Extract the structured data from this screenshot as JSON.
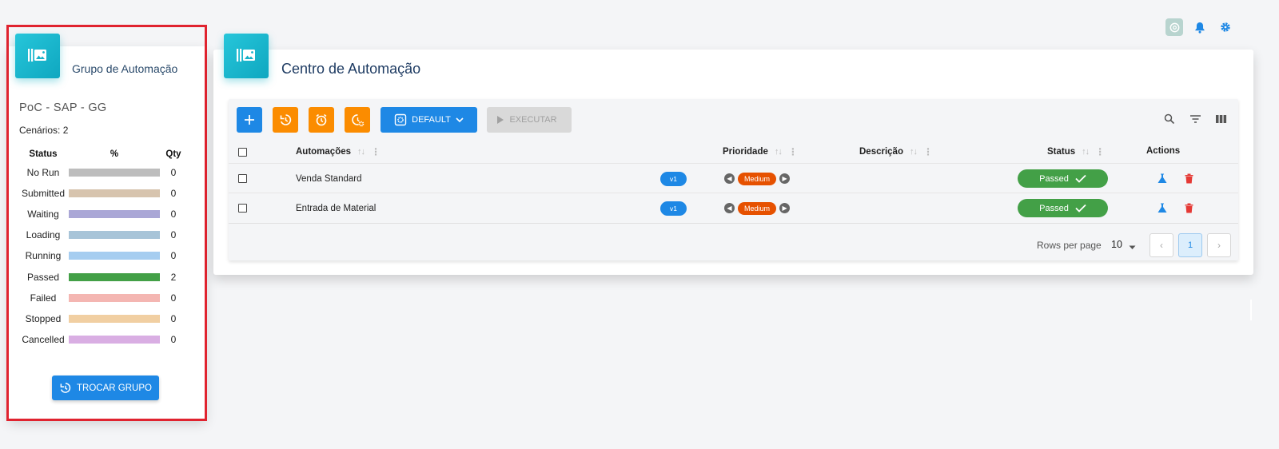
{
  "colors": {
    "accent": "#1e88e5",
    "orange": "#fb8c00",
    "teal": "#26c6da",
    "passed": "#43a047",
    "priority": "#e65100",
    "delete": "#e53935"
  },
  "header_icons": [
    "chatgpt-icon",
    "bell-icon",
    "gear-icon"
  ],
  "group_card": {
    "title": "Grupo de Automação",
    "group_name": "PoC - SAP - GG",
    "scenarios": "Cenários: 2",
    "columns": {
      "status": "Status",
      "percent": "%",
      "qty": "Qty"
    },
    "rows": [
      {
        "status": "No Run",
        "qty": "0",
        "color": "#bdbdbd"
      },
      {
        "status": "Submitted",
        "qty": "0",
        "color": "#d7c4ae"
      },
      {
        "status": "Waiting",
        "qty": "0",
        "color": "#aaa7d6"
      },
      {
        "status": "Loading",
        "qty": "0",
        "color": "#a8c4d8"
      },
      {
        "status": "Running",
        "qty": "0",
        "color": "#a6cdf0"
      },
      {
        "status": "Passed",
        "qty": "2",
        "color": "#43a047"
      },
      {
        "status": "Failed",
        "qty": "0",
        "color": "#f4b6b2"
      },
      {
        "status": "Stopped",
        "qty": "0",
        "color": "#f1cfa2"
      },
      {
        "status": "Cancelled",
        "qty": "0",
        "color": "#d9aee3"
      }
    ],
    "button_label": "TROCAR GRUPO"
  },
  "main_card": {
    "title": "Centro de Automação",
    "toolbar": {
      "default_label": "DEFAULT",
      "execute_label": "EXECUTAR",
      "icons": [
        "add-icon",
        "history-icon",
        "alarm-icon",
        "schedule-settings-icon"
      ]
    },
    "table": {
      "headers": {
        "automations": "Automações",
        "priority": "Prioridade",
        "description": "Descrição",
        "status": "Status",
        "actions": "Actions"
      },
      "rows": [
        {
          "name": "Venda Standard",
          "version": "v1",
          "priority": "Medium",
          "description": "",
          "status": "Passed"
        },
        {
          "name": "Entrada de Material",
          "version": "v1",
          "priority": "Medium",
          "description": "",
          "status": "Passed"
        }
      ]
    },
    "pagination": {
      "rows_per_page_label": "Rows per page",
      "rows_per_page": "10",
      "current_page": "1"
    }
  }
}
